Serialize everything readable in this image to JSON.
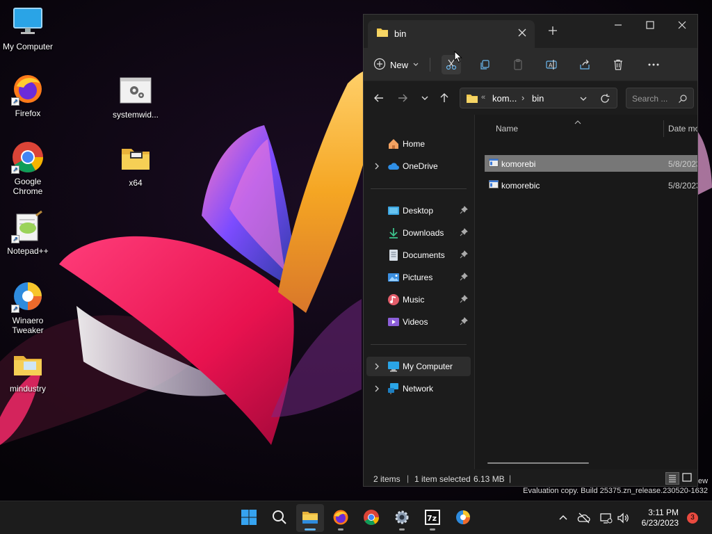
{
  "desktop": {
    "icons": [
      {
        "label": "My Computer",
        "icon": "monitor-icon"
      },
      {
        "label": "Firefox",
        "icon": "firefox-icon"
      },
      {
        "label": "Google Chrome",
        "icon": "chrome-icon"
      },
      {
        "label": "Notepad++",
        "icon": "notepadpp-icon"
      },
      {
        "label": "Winaero Tweaker",
        "icon": "winaero-icon"
      },
      {
        "label": "mindustry",
        "icon": "folder-icon"
      },
      {
        "label": "systemwid...",
        "icon": "settings-file-icon"
      },
      {
        "label": "x64",
        "icon": "folder-icon"
      }
    ]
  },
  "explorer": {
    "tab_title": "bin",
    "commandbar": {
      "new_label": "New"
    },
    "address": {
      "overflow": "«",
      "crumb1": "kom...",
      "separator": "›",
      "crumb2": "bin"
    },
    "search_placeholder": "Search ...",
    "nav": {
      "home": "Home",
      "onedrive": "OneDrive",
      "desktop": "Desktop",
      "downloads": "Downloads",
      "documents": "Documents",
      "pictures": "Pictures",
      "music": "Music",
      "videos": "Videos",
      "my_computer": "My Computer",
      "network": "Network"
    },
    "columns": {
      "name": "Name",
      "date": "Date mo"
    },
    "files": [
      {
        "name": "komorebi",
        "date": "5/8/2023"
      },
      {
        "name": "komorebic",
        "date": "5/8/2023"
      }
    ],
    "status": {
      "items": "2 items",
      "sep": "|",
      "selected": "1 item selected",
      "size": "6.13 MB"
    }
  },
  "watermark": "Evaluation copy. Build 25375.zn_release.230520-1632",
  "peek_text": "ew",
  "taskbar": {
    "time": "3:11 PM",
    "date": "6/23/2023",
    "notification_count": "3"
  },
  "colors": {
    "accent": "#5fb2f2",
    "folder": "#f2c94c",
    "badge": "#e94a3f"
  }
}
